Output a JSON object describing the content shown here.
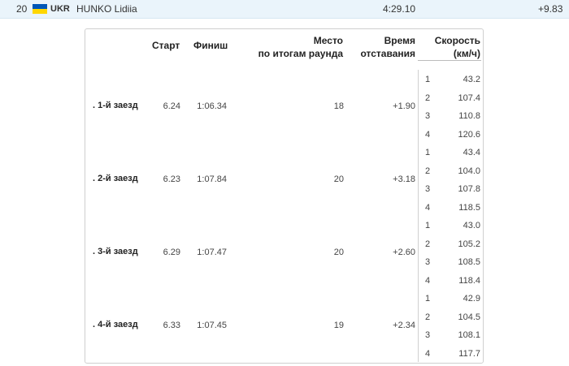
{
  "athlete": {
    "rank": "20",
    "country": "UKR",
    "name": "HUNKO Lidiia",
    "total_time": "4:29.10",
    "behind": "+9.83",
    "flag_colors": [
      "#0057b8",
      "#ffd700"
    ]
  },
  "headers": {
    "start": "Старт",
    "finish": "Финиш",
    "place_1": "Место",
    "place_2": "по итогам раунда",
    "gap_1": "Время",
    "gap_2": "отставания",
    "speed_1": "Скорость",
    "speed_2": "(км/ч)"
  },
  "runs": [
    {
      "label": ". 1-й заезд",
      "start": "6.24",
      "finish": "1:06.34",
      "place": "18",
      "gap": "+1.90",
      "speeds": [
        {
          "n": "1",
          "v": "43.2"
        },
        {
          "n": "2",
          "v": "107.4"
        },
        {
          "n": "3",
          "v": "110.8"
        },
        {
          "n": "4",
          "v": "120.6"
        }
      ]
    },
    {
      "label": ". 2-й заезд",
      "start": "6.23",
      "finish": "1:07.84",
      "place": "20",
      "gap": "+3.18",
      "speeds": [
        {
          "n": "1",
          "v": "43.4"
        },
        {
          "n": "2",
          "v": "104.0"
        },
        {
          "n": "3",
          "v": "107.8"
        },
        {
          "n": "4",
          "v": "118.5"
        }
      ]
    },
    {
      "label": ". 3-й заезд",
      "start": "6.29",
      "finish": "1:07.47",
      "place": "20",
      "gap": "+2.60",
      "speeds": [
        {
          "n": "1",
          "v": "43.0"
        },
        {
          "n": "2",
          "v": "105.2"
        },
        {
          "n": "3",
          "v": "108.5"
        },
        {
          "n": "4",
          "v": "118.4"
        }
      ]
    },
    {
      "label": ". 4-й заезд",
      "start": "6.33",
      "finish": "1:07.45",
      "place": "19",
      "gap": "+2.34",
      "speeds": [
        {
          "n": "1",
          "v": "42.9"
        },
        {
          "n": "2",
          "v": "104.5"
        },
        {
          "n": "3",
          "v": "108.1"
        },
        {
          "n": "4",
          "v": "117.7"
        }
      ]
    }
  ]
}
